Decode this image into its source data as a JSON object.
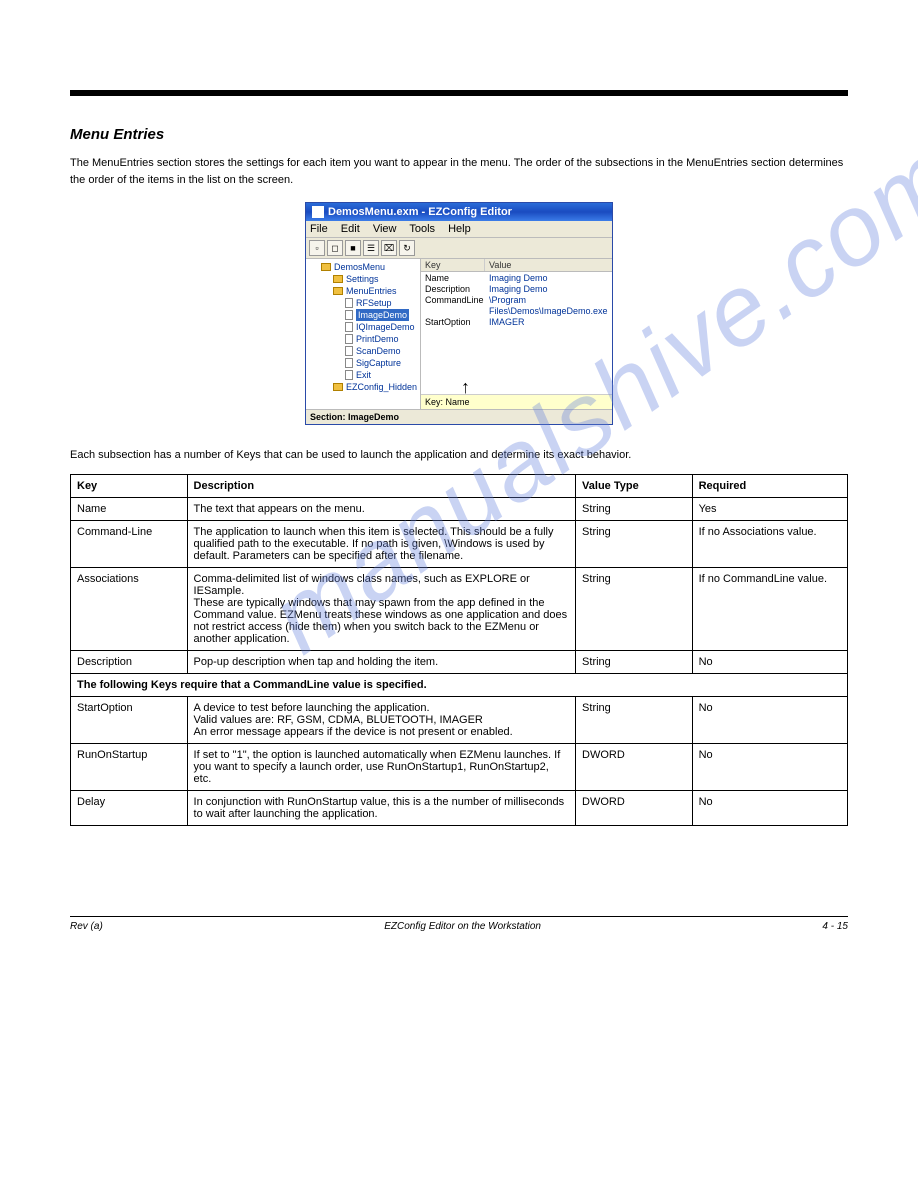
{
  "page": {
    "sectionTitle": "Menu Entries",
    "intro": "The MenuEntries section stores the settings for each item you want to appear in the menu. The order of the subsections in the MenuEntries section determines the order of the items in the list on the screen.",
    "note": "Each subsection has a number of Keys that can be used to launch the application and determine its exact behavior.",
    "watermark": "manualshive.com"
  },
  "app": {
    "title": "DemosMenu.exm - EZConfig Editor",
    "menubar": [
      "File",
      "Edit",
      "View",
      "Tools",
      "Help"
    ],
    "toolbarIcons": [
      "new",
      "open",
      "save",
      "prefs",
      "tree",
      "refresh"
    ],
    "tree": {
      "root": "DemosMenu",
      "items": [
        {
          "label": "Settings",
          "level": 2,
          "type": "folder"
        },
        {
          "label": "MenuEntries",
          "level": 2,
          "type": "folder"
        },
        {
          "label": "RFSetup",
          "level": 3,
          "type": "file"
        },
        {
          "label": "ImageDemo",
          "level": 3,
          "type": "file",
          "selected": true
        },
        {
          "label": "IQImageDemo",
          "level": 3,
          "type": "file"
        },
        {
          "label": "PrintDemo",
          "level": 3,
          "type": "file"
        },
        {
          "label": "ScanDemo",
          "level": 3,
          "type": "file"
        },
        {
          "label": "SigCapture",
          "level": 3,
          "type": "file"
        },
        {
          "label": "Exit",
          "level": 3,
          "type": "file"
        },
        {
          "label": "EZConfig_Hidden",
          "level": 2,
          "type": "folder"
        }
      ]
    },
    "kvHeader": {
      "key": "Key",
      "value": "Value"
    },
    "kvRows": [
      {
        "k": "Name",
        "v": "Imaging Demo"
      },
      {
        "k": "Description",
        "v": "Imaging Demo"
      },
      {
        "k": "CommandLine",
        "v": "\\Program Files\\Demos\\ImageDemo.exe"
      },
      {
        "k": "StartOption",
        "v": "IMAGER"
      }
    ],
    "keyNameLabel": "Key: Name",
    "statusBar": "Section: ImageDemo"
  },
  "table": {
    "headers": [
      "Key",
      "Description",
      "Value Type",
      "Required"
    ],
    "rows": [
      {
        "key": "Name",
        "desc": "The text that appears on the menu.",
        "type": "String",
        "req": "Yes"
      },
      {
        "key": "Command-Line",
        "desc": "The application to launch when this item is selected. This should be a fully qualified path to the executable. If no path is given, \\Windows is used by default. Parameters can be specified after the filename.",
        "type": "String",
        "req": "If no Associations value."
      },
      {
        "key": "Associations",
        "desc": "Comma-delimited list of windows class names, such as EXPLORE or IESample.\nThese are typically windows that may spawn from the app defined in the Command value. EZMenu treats these windows as one application and does not restrict access (hide them) when you switch back to the EZMenu or another application.",
        "type": "String",
        "req": "If no CommandLine value."
      },
      {
        "key": "Description",
        "desc": "Pop-up description when tap and holding the item.",
        "type": "String",
        "req": "No"
      }
    ],
    "subhead": "The following Keys require that a CommandLine value is specified.",
    "rows2": [
      {
        "key": "StartOption",
        "desc": "A device to test before launching the application.\nValid values are: RF, GSM, CDMA, BLUETOOTH, IMAGER\nAn error message appears if the device is not present or enabled.",
        "type": "String",
        "req": "No"
      },
      {
        "key": "RunOnStartup",
        "desc": "If set to \"1\", the option is launched automatically when EZMenu launches. If you want to specify a launch order, use RunOnStartup1, RunOnStartup2, etc.",
        "type": "DWORD",
        "req": "No"
      },
      {
        "key": "Delay",
        "desc": "In conjunction with RunOnStartup value, this is a the number of milliseconds to wait after launching the application.",
        "type": "DWORD",
        "req": "No"
      }
    ]
  },
  "footer": {
    "left": "Rev (a)",
    "center": "EZConfig Editor on the Workstation",
    "right": "4 - 15"
  }
}
